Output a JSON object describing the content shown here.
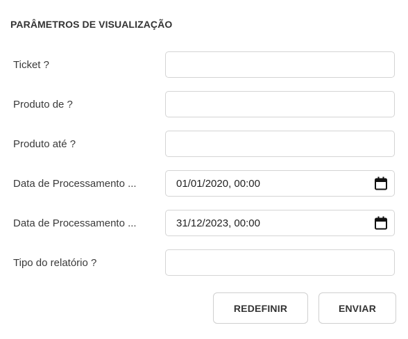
{
  "section_title": "PARÂMETROS DE VISUALIZAÇÃO",
  "fields": [
    {
      "label": "Ticket ?",
      "value": ""
    },
    {
      "label": "Produto de ?",
      "value": ""
    },
    {
      "label": "Produto até ?",
      "value": ""
    },
    {
      "label": "Data de Processamento ...",
      "value": "01/01/2020, 00:00",
      "icon": "calendar-icon"
    },
    {
      "label": "Data de Processamento ...",
      "value": "31/12/2023, 00:00",
      "icon": "calendar-icon"
    },
    {
      "label": "Tipo do relatório ?",
      "value": ""
    }
  ],
  "buttons": {
    "reset_label": "REDEFINIR",
    "submit_label": "ENVIAR"
  }
}
